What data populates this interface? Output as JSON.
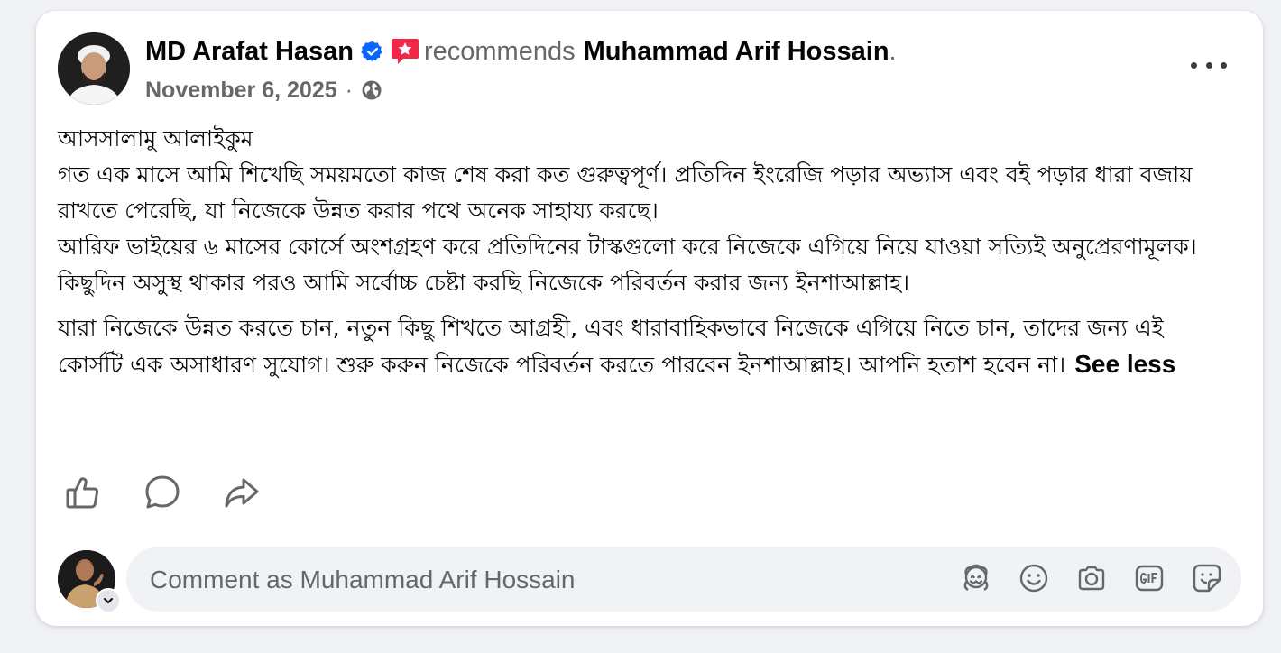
{
  "post": {
    "author": "MD Arafat Hasan",
    "action_text": "recommends",
    "recommended_page": "Muhammad Arif Hossain",
    "period": ".",
    "date": "November 6, 2025",
    "separator": "·",
    "privacy_icon": "globe-icon",
    "more_icon": "more-options-icon",
    "body_paragraphs": [
      [
        "আসসালামু আলাইকুম",
        "গত এক মাসে আমি শিখেছি সময়মতো কাজ শেষ করা কত গুরুত্বপূর্ণ। প্রতিদিন ইংরেজি পড়ার অভ্যাস এবং বই পড়ার ধারা বজায় রাখতে পেরেছি, যা নিজেকে উন্নত করার পথে অনেক সাহায্য করছে।",
        "আরিফ ভাইয়ের ৬ মাসের কোর্সে অংশগ্রহণ করে প্রতিদিনের টাস্কগুলো করে নিজেকে এগিয়ে নিয়ে যাওয়া সত্যিই অনুপ্রেরণামূলক। কিছুদিন অসুস্থ থাকার পরও আমি সর্বোচ্চ চেষ্টা করছি নিজেকে পরিবর্তন করার জন্য ইনশাআল্লাহ।"
      ],
      [
        "যারা নিজেকে উন্নত করতে চান, নতুন কিছু শিখতে আগ্রহী, এবং ধারাবাহিকভাবে নিজেকে এগিয়ে নিতে চান, তাদের জন্য এই কোর্সটি এক অসাধারণ সুযোগ। শুরু করুন নিজেকে পরিবর্তন করতে পারবেন ইনশাআল্লাহ। আপনি হতাশ হবেন না।"
      ]
    ],
    "see_less_label": "See less"
  },
  "actions": [
    {
      "name": "like",
      "icon": "thumbs-up-icon"
    },
    {
      "name": "comment",
      "icon": "comment-bubble-icon"
    },
    {
      "name": "share",
      "icon": "share-arrow-icon"
    }
  ],
  "comment": {
    "placeholder": "Comment as Muhammad Arif Hossain",
    "value": "",
    "tools": [
      "avatar-sticker-icon",
      "emoji-icon",
      "camera-icon",
      "gif-icon",
      "sticker-icon"
    ]
  },
  "colors": {
    "verified_blue": "#0866ff",
    "recommend_red": "#f02849",
    "secondary_text": "#65676b",
    "icon_gray": "#65676b"
  }
}
